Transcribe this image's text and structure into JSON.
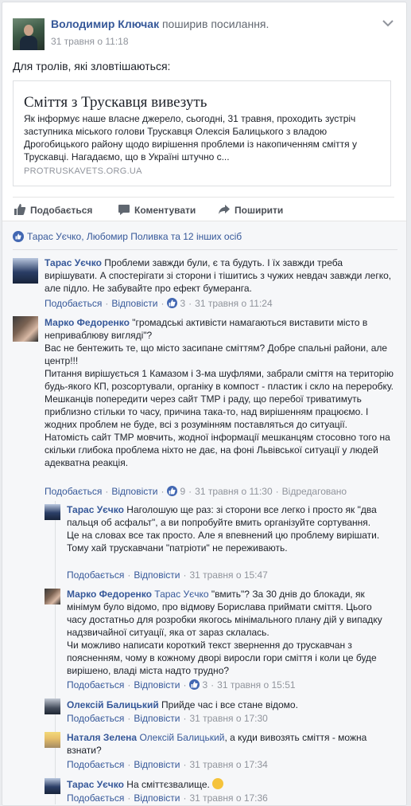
{
  "post": {
    "author": "Володимир Ключак",
    "action": "поширив посилання.",
    "date": "31 травня о 11:18",
    "text": "Для тролів, які зловтішаються:",
    "link": {
      "title": "Сміття з Трускавця вивезуть",
      "description": "Як інформує наше власне джерело, сьогодні, 31 травня, проходить зустріч заступника міського голови Трускавця Олексія Балицького з владою Дрогобицького району щодо вирішення проблеми із накопиченням сміття у Трускавці. Нагадаємо, що в Україні штучно с...",
      "domain": "PROTRUSKAVETS.ORG.UA"
    }
  },
  "actions": {
    "like": "Подобається",
    "comment": "Коментувати",
    "share": "Поширити"
  },
  "reactions_text": "Тарас Уєчко, Любомир Поливка та 12 інших осіб",
  "meta_labels": {
    "like": "Подобається",
    "reply": "Відповісти",
    "edited": "Відредаговано"
  },
  "comments": [
    {
      "author": "Тарас Уєчко",
      "text": "Проблеми завжди були, є та будуть. І їх завжди треба вирішувати. А спостерігати зі сторони і тішитись з чужих невдач завжди легко, але підло. Не забувайте про ефект бумеранга.",
      "likes": "3",
      "time": "31 травня о 11:24"
    },
    {
      "author": "Марко Федоренко",
      "p1": "\"громадські активісти намагаються виставити місто в неприваблюву вигляді\"?",
      "p2": "Вас не бентежить те, що місто засипане сміттям? Добре спальні райони, але центр!!!",
      "p3": "Питання вирішується 1 Камазом і 3-ма шуфлями, забрали сміття на територію будь-якого КП, розсортували, органіку в компост - пластик і скло на переробку. Мешканців попередити через сайт ТМР і раду, що перебої триватимуть приблизно стільки то часу, причина така-то, над вирішенням працюємо. І жодних проблем не буде, всі з розумінням поставляться до ситуації.",
      "p4": "Натомість сайт ТМР мовчить, жодної інформації мешканцям стосовно того на скільки глибока проблема ніхто не дає, на фоні Львівської ситуації у людей адекватна реакція.",
      "likes": "9",
      "time": "31 травня о 11:30"
    }
  ],
  "replies": [
    {
      "author": "Тарас Уєчко",
      "text": "Наголошую ще раз: зі сторони все легко і просто як \"два пальця об асфальт\", а ви попробуйте вмить організуйте сортування. Це на словах все так просто. Але я впевнений цю проблему вирішати. Тому хай трускавчани \"патріоти\" не переживають.",
      "time": "31 травня о 15:47"
    },
    {
      "author": "Марко Федоренко",
      "tag": "Тарас Уєчко",
      "text": "\"вмить\"? За 30 днів до блокади, як мінімум було відомо, про відмову Борислава приймати сміття. Цього часу достатньо для розробки якогось мінімального плану дій у випадку надзвичайної ситуації, яка от зараз склалась.",
      "text2": "Чи можливо написати короткий текст звернення до трускавчан з поясненням, чому в кожному дворі виросли гори сміття і коли це буде вирішено, владі міста надто трудно?",
      "likes": "3",
      "time": "31 травня о 15:51"
    },
    {
      "author": "Олексій Балицький",
      "text": "Прийде час і все стане відомо.",
      "time": "31 травня о 17:30"
    },
    {
      "author": "Наталя Зелена",
      "tag": "Олексій Балицький",
      "text": ", а куди вивозять сміття - можна взнати?",
      "time": "31 травня о 17:34"
    },
    {
      "author": "Тарас Уєчко",
      "text": "На сміттєзвалище.",
      "emoji": "🙂",
      "time": "31 травня о 17:36"
    }
  ]
}
